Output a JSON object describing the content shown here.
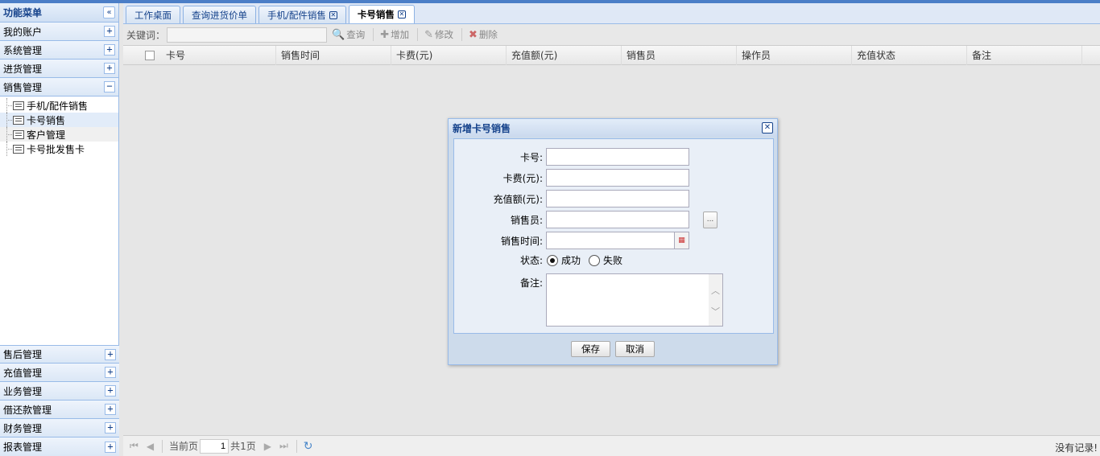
{
  "sidebar": {
    "title": "功能菜单",
    "collapse_glyph": "«",
    "top_sections": [
      {
        "label": "我的账户",
        "toggle": "+"
      },
      {
        "label": "系统管理",
        "toggle": "+"
      },
      {
        "label": "进货管理",
        "toggle": "+"
      },
      {
        "label": "销售管理",
        "toggle": "−"
      }
    ],
    "tree_items": [
      {
        "label": "手机/配件销售"
      },
      {
        "label": "卡号销售"
      },
      {
        "label": "客户管理"
      },
      {
        "label": "卡号批发售卡"
      }
    ],
    "bottom_sections": [
      {
        "label": "售后管理",
        "toggle": "+"
      },
      {
        "label": "充值管理",
        "toggle": "+"
      },
      {
        "label": "业务管理",
        "toggle": "+"
      },
      {
        "label": "借还款管理",
        "toggle": "+"
      },
      {
        "label": "财务管理",
        "toggle": "+"
      },
      {
        "label": "报表管理",
        "toggle": "+"
      }
    ]
  },
  "tabs": [
    {
      "label": "工作桌面"
    },
    {
      "label": "查询进货价单"
    },
    {
      "label": "手机/配件销售"
    },
    {
      "label": "卡号销售"
    }
  ],
  "toolbar": {
    "keyword_label": "关键词：",
    "keyword_value": "",
    "search": "查询",
    "add": "增加",
    "edit": "修改",
    "delete": "删除"
  },
  "grid": {
    "columns": [
      "卡号",
      "销售时间",
      "卡费(元)",
      "充值额(元)",
      "销售员",
      "操作员",
      "充值状态",
      "备注"
    ]
  },
  "pager": {
    "current_label": "当前页",
    "page": "1",
    "total": "共1页",
    "empty": "没有记录!"
  },
  "dialog": {
    "title": "新增卡号销售",
    "close": "✕",
    "fields": {
      "card_no": {
        "label": "卡号:",
        "value": ""
      },
      "card_fee": {
        "label": "卡费(元):",
        "value": ""
      },
      "recharge": {
        "label": "充值额(元):",
        "value": ""
      },
      "seller": {
        "label": "销售员:",
        "value": "",
        "picker": "..."
      },
      "sale_time": {
        "label": "销售时间:",
        "value": ""
      },
      "status": {
        "label": "状态:",
        "options": [
          "成功",
          "失败"
        ],
        "selected": "成功"
      },
      "remark": {
        "label": "备注:",
        "value": ""
      }
    },
    "save": "保存",
    "cancel": "取消"
  }
}
